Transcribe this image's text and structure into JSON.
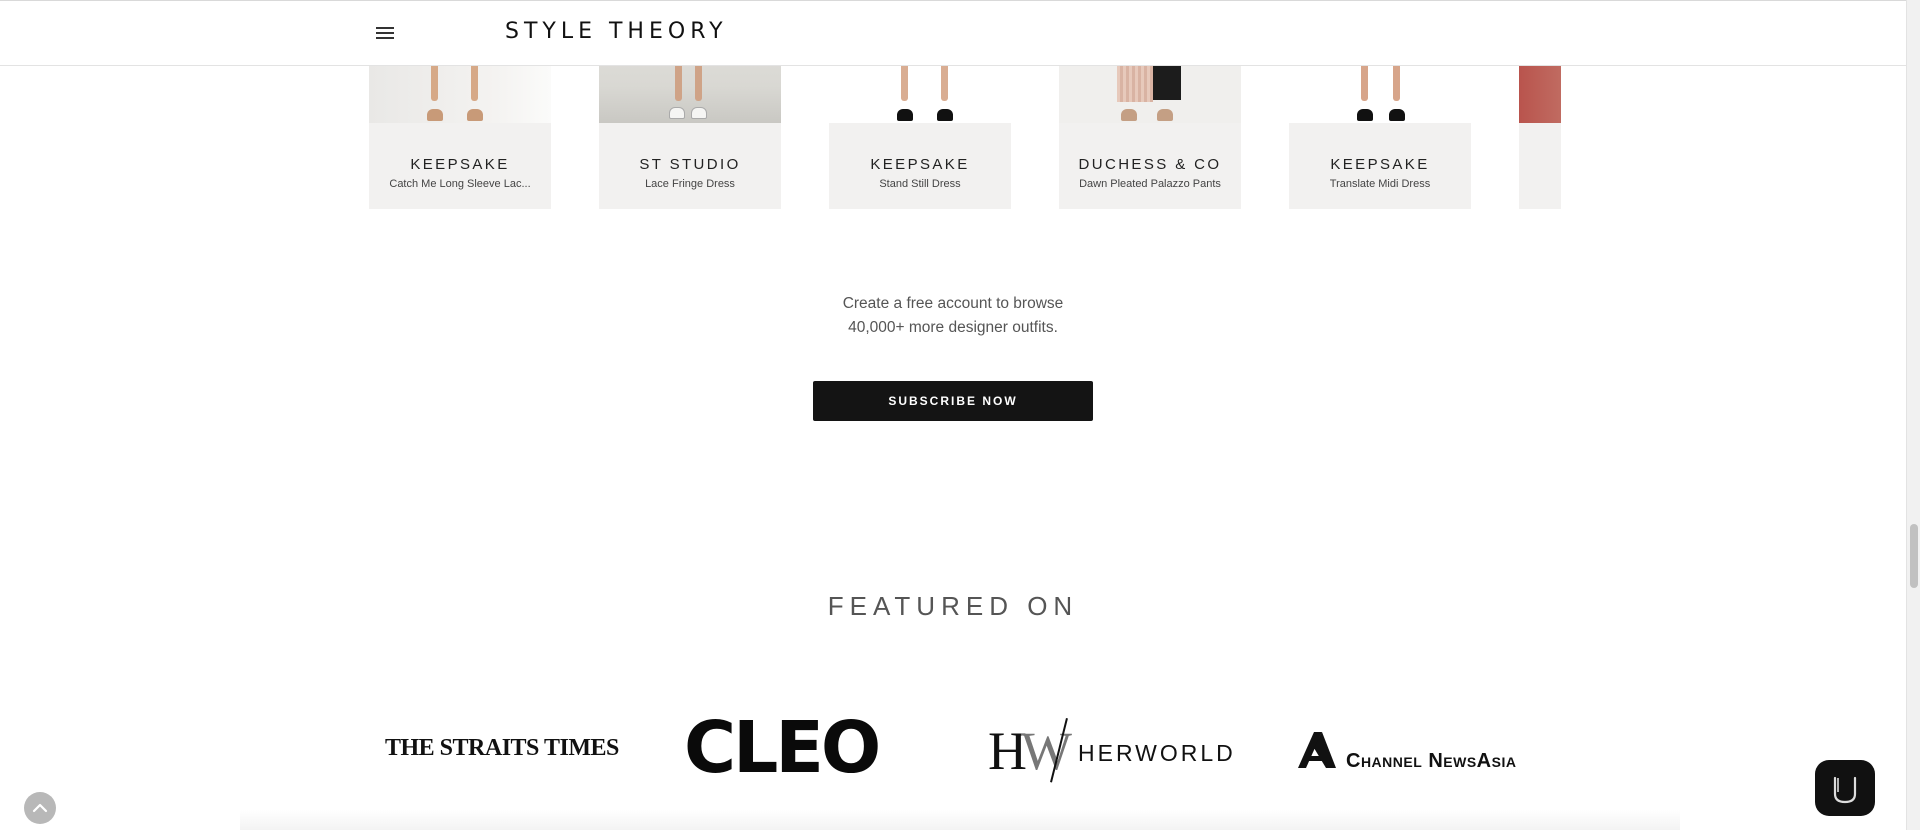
{
  "header": {
    "brand": "STYLE THEORY",
    "menu_icon": "hamburger-menu-icon"
  },
  "products": [
    {
      "brand": "KEEPSAKE",
      "name": "Catch Me Long Sleeve Lac..."
    },
    {
      "brand": "ST STUDIO",
      "name": "Lace Fringe Dress"
    },
    {
      "brand": "KEEPSAKE",
      "name": "Stand Still Dress"
    },
    {
      "brand": "DUCHESS & CO",
      "name": "Dawn Pleated Palazzo Pants"
    },
    {
      "brand": "KEEPSAKE",
      "name": "Translate Midi Dress"
    }
  ],
  "cta": {
    "line1": "Create a free account to browse",
    "line2": "40,000+ more designer outfits.",
    "button": "SUBSCRIBE NOW"
  },
  "featured": {
    "title": "FEATURED ON",
    "logos": {
      "straits_times": "THE STRAITS TIMES",
      "cleo": "CLEO",
      "herworld_mark_h": "H",
      "herworld_mark_w": "W",
      "herworld": "HERWORLD",
      "cna": "Channel NewsAsia"
    }
  },
  "floating": {
    "back_to_top_icon": "chevron-up-icon",
    "chat_icon": "chat-icon"
  },
  "colors": {
    "accent_dark": "#141414",
    "card_bg": "#f2f1f0",
    "text_muted": "#555555"
  }
}
